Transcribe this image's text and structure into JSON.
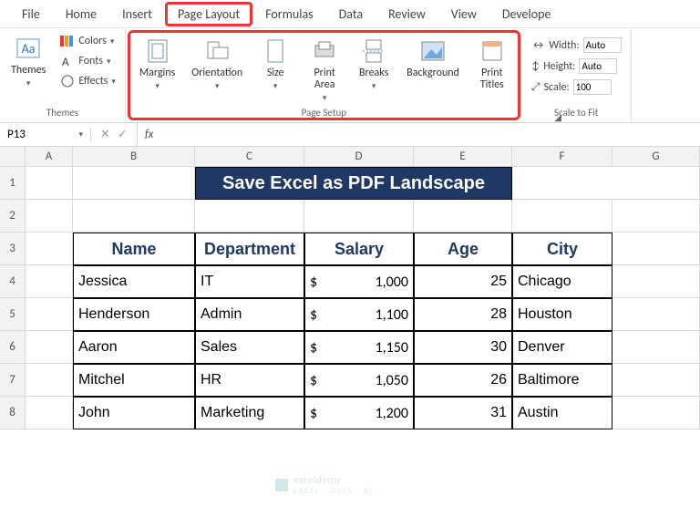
{
  "tabs": [
    "File",
    "Home",
    "Insert",
    "Page Layout",
    "Formulas",
    "Data",
    "Review",
    "View",
    "Develope"
  ],
  "active_tab_index": 3,
  "groups": {
    "themes": {
      "label": "Themes",
      "main": "Themes",
      "colors": "Colors",
      "fonts": "Fonts",
      "effects": "Effects"
    },
    "page_setup": {
      "label": "Page Setup",
      "margins": "Margins",
      "orientation": "Orientation",
      "size": "Size",
      "print_area": "Print\nArea",
      "breaks": "Breaks",
      "background": "Background",
      "print_titles": "Print\nTitles"
    },
    "scale": {
      "label": "Scale to Fit",
      "width_label": "Width:",
      "width_value": "Auto",
      "height_label": "Height:",
      "height_value": "Auto",
      "scale_label": "Scale:",
      "scale_value": "100"
    }
  },
  "name_box": "P13",
  "columns": [
    "A",
    "B",
    "C",
    "D",
    "E",
    "F",
    "G"
  ],
  "rows": [
    "1",
    "2",
    "3",
    "4",
    "5",
    "6",
    "7",
    "8"
  ],
  "title": "Save Excel as PDF Landscape",
  "headers": [
    "Name",
    "Department",
    "Salary",
    "Age",
    "City"
  ],
  "data": [
    {
      "name": "Jessica",
      "dept": "IT",
      "salary": "1,000",
      "age": "25",
      "city": "Chicago"
    },
    {
      "name": "Henderson",
      "dept": "Admin",
      "salary": "1,100",
      "age": "28",
      "city": "Houston"
    },
    {
      "name": "Aaron",
      "dept": "Sales",
      "salary": "1,150",
      "age": "30",
      "city": "Denver"
    },
    {
      "name": "Mitchel",
      "dept": "HR",
      "salary": "1,050",
      "age": "26",
      "city": "Baltimore"
    },
    {
      "name": "John",
      "dept": "Marketing",
      "salary": "1,200",
      "age": "31",
      "city": "Austin"
    }
  ],
  "currency": "$",
  "watermark": {
    "brand": "exceldemy",
    "tag": "EXCEL · DATA · BI"
  }
}
